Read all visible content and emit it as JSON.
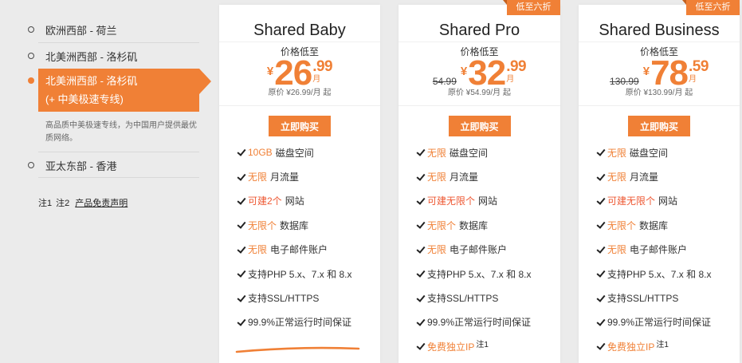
{
  "colors": {
    "accent": "#f08036",
    "accent_red": "#ee5833",
    "page_bg": "#ebebeb",
    "card_bg": "#ffffff"
  },
  "icons": {
    "region_unselected": "radio-unchecked-icon",
    "region_selected": "radio-checked-icon",
    "feature_bullet": "check-icon"
  },
  "regions": {
    "items": [
      {
        "label": "欧洲西部 - 荷兰",
        "selected": false
      },
      {
        "label": "北美洲西部 - 洛杉矶",
        "selected": false
      },
      {
        "label": "北美洲西部 - 洛杉矶",
        "sublabel": "(+ 中美极速专线)",
        "selected": true
      },
      {
        "label": "亚太东部 - 香港",
        "selected": false
      }
    ],
    "selected_description": "高品质中美极速专线，为中国用户提供最优质网络。"
  },
  "footer": {
    "note1": "注1",
    "note2": "注2",
    "disclaimer": "产品免责声明"
  },
  "plans": [
    {
      "name": "Shared Baby",
      "ribbon": "",
      "price_label": "价格低至",
      "strike_price": "",
      "currency": "¥",
      "price_int": "26",
      "price_dec": ".99",
      "unit": "月",
      "original_note": "原价 ¥26.99/月 起",
      "button": "立即购买",
      "features": [
        {
          "highlight": "10GB",
          "text": "磁盘空间"
        },
        {
          "highlight": "无限",
          "text": "月流量"
        },
        {
          "highlight": "可建2个",
          "text": "网站",
          "tone": "red"
        },
        {
          "highlight": "无限个",
          "text": "数据库"
        },
        {
          "highlight": "无限",
          "text": "电子邮件账户"
        },
        {
          "highlight": "",
          "text": "支持PHP 5.x、7.x 和 8.x"
        },
        {
          "highlight": "",
          "text": "支持SSL/HTTPS"
        },
        {
          "highlight": "",
          "text": "99.9%正常运行时间保证"
        }
      ]
    },
    {
      "name": "Shared Pro",
      "ribbon": "低至六折",
      "price_label": "价格低至",
      "strike_price": "54.99",
      "currency": "¥",
      "price_int": "32",
      "price_dec": ".99",
      "unit": "月",
      "original_note": "原价 ¥54.99/月 起",
      "button": "立即购买",
      "features": [
        {
          "highlight": "无限",
          "text": "磁盘空间"
        },
        {
          "highlight": "无限",
          "text": "月流量"
        },
        {
          "highlight": "可建无限个",
          "text": "网站",
          "tone": "red"
        },
        {
          "highlight": "无限个",
          "text": "数据库"
        },
        {
          "highlight": "无限",
          "text": "电子邮件账户"
        },
        {
          "highlight": "",
          "text": "支持PHP 5.x、7.x 和 8.x"
        },
        {
          "highlight": "",
          "text": "支持SSL/HTTPS"
        },
        {
          "highlight": "",
          "text": "99.9%正常运行时间保证"
        },
        {
          "highlight": "免费独立IP",
          "text": "",
          "note": "注1"
        }
      ]
    },
    {
      "name": "Shared Business",
      "ribbon": "低至六折",
      "price_label": "价格低至",
      "strike_price": "130.99",
      "currency": "¥",
      "price_int": "78",
      "price_dec": ".59",
      "unit": "月",
      "original_note": "原价 ¥130.99/月 起",
      "button": "立即购买",
      "features": [
        {
          "highlight": "无限",
          "text": "磁盘空间"
        },
        {
          "highlight": "无限",
          "text": "月流量"
        },
        {
          "highlight": "可建无限个",
          "text": "网站",
          "tone": "red"
        },
        {
          "highlight": "无限个",
          "text": "数据库"
        },
        {
          "highlight": "无限",
          "text": "电子邮件账户"
        },
        {
          "highlight": "",
          "text": "支持PHP 5.x、7.x 和 8.x"
        },
        {
          "highlight": "",
          "text": "支持SSL/HTTPS"
        },
        {
          "highlight": "",
          "text": "99.9%正常运行时间保证"
        },
        {
          "highlight": "免费独立IP",
          "text": "",
          "note": "注1"
        }
      ]
    }
  ]
}
